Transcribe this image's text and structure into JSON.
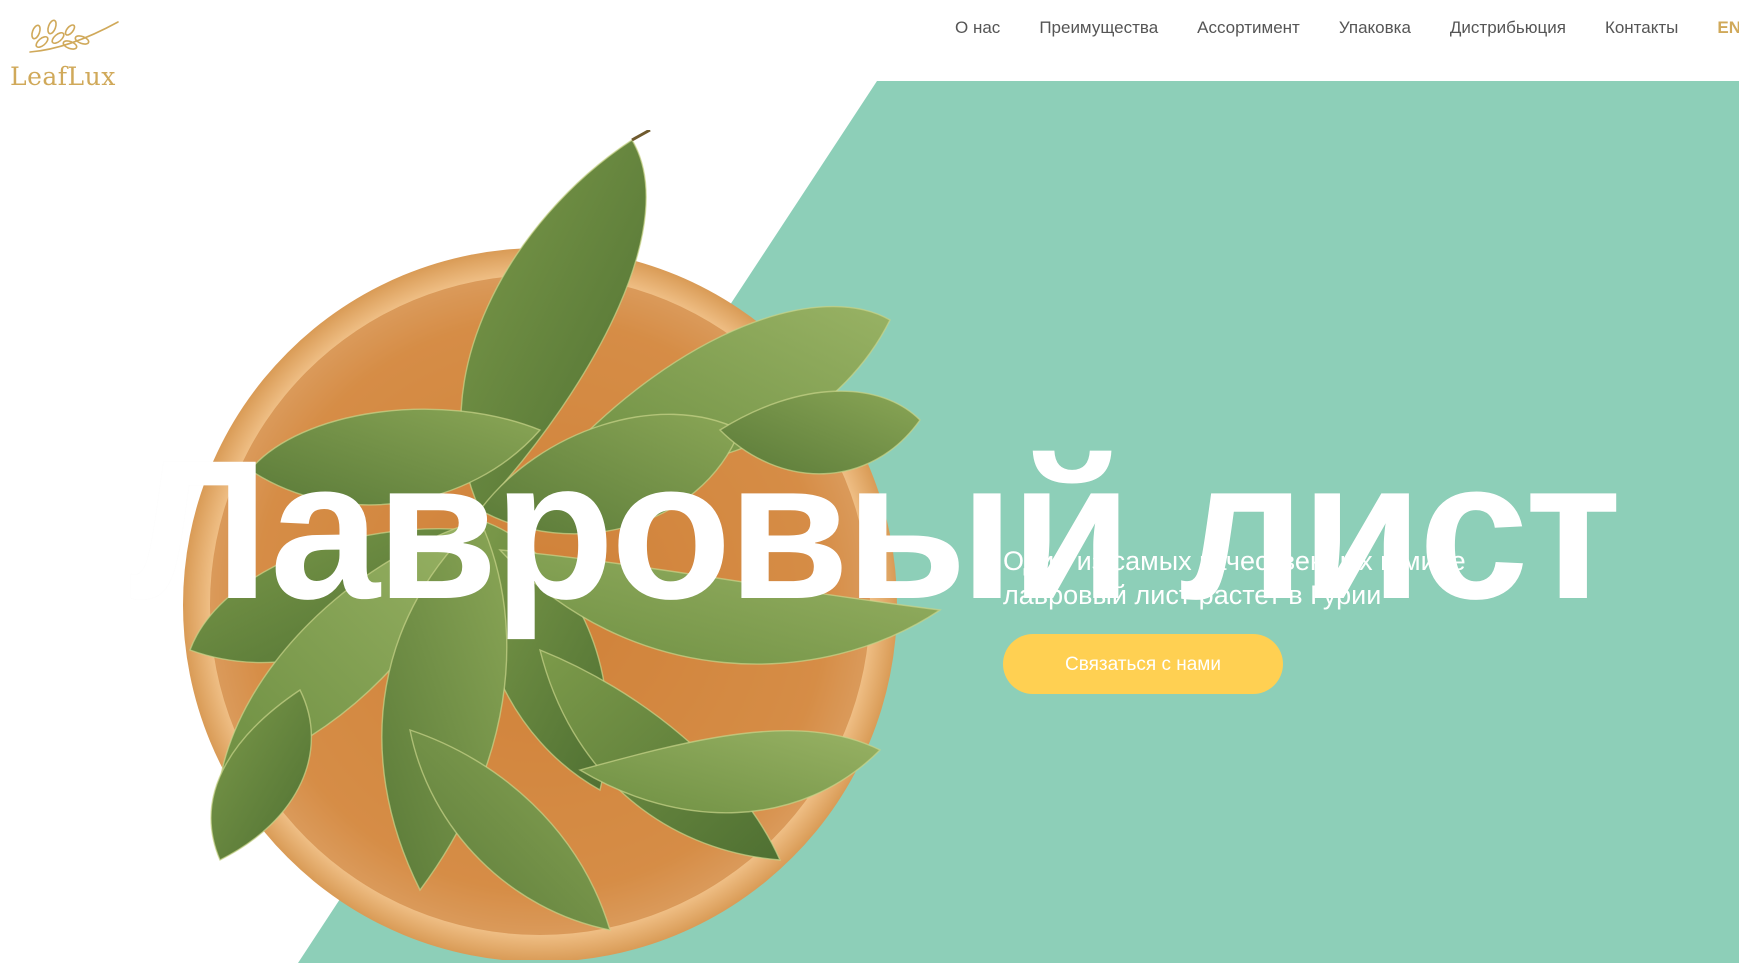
{
  "brand": {
    "logo_text": "LeafLux",
    "logo_icon": "laurel-branch-icon",
    "color": "#d0a95a"
  },
  "nav": {
    "items": [
      {
        "label": "О нас"
      },
      {
        "label": "Преимущества"
      },
      {
        "label": "Ассортимент"
      },
      {
        "label": "Упаковка"
      },
      {
        "label": "Дистрибьюция"
      },
      {
        "label": "Контакты"
      }
    ],
    "language": "EN"
  },
  "hero": {
    "title": "Лавровый лист",
    "subtitle": "Один из самых качественных в мире лавровый лист растет в Гурии",
    "cta_label": "Связаться с нами",
    "accent_color": "#8dcfb8",
    "button_color": "#ffd052"
  }
}
